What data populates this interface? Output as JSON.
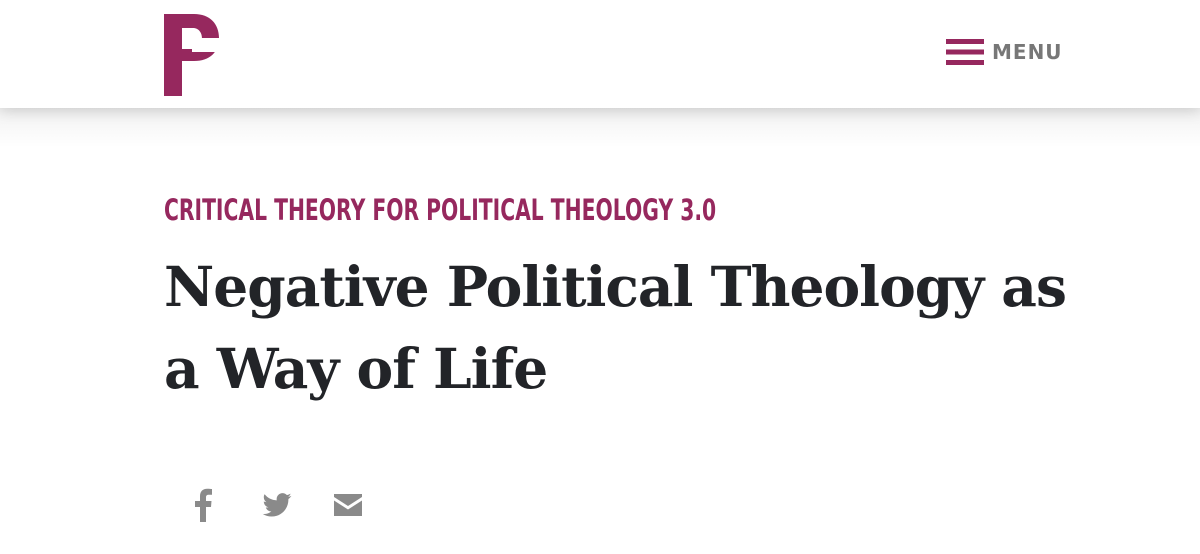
{
  "header": {
    "logo_icon": "p-logo-icon",
    "menu_icon": "hamburger-menu-icon",
    "menu_label": "MENU"
  },
  "article": {
    "kicker": "CRITICAL THEORY FOR POLITICAL THEOLOGY 3.0",
    "title": "Negative Political Theology as a Way of Life"
  },
  "share": {
    "icons": [
      "facebook-icon",
      "twitter-icon",
      "email-icon"
    ]
  },
  "colors": {
    "brand": "#96285e",
    "title": "#222428",
    "menu_text": "#777777",
    "share_icon": "#8a8a8a"
  }
}
